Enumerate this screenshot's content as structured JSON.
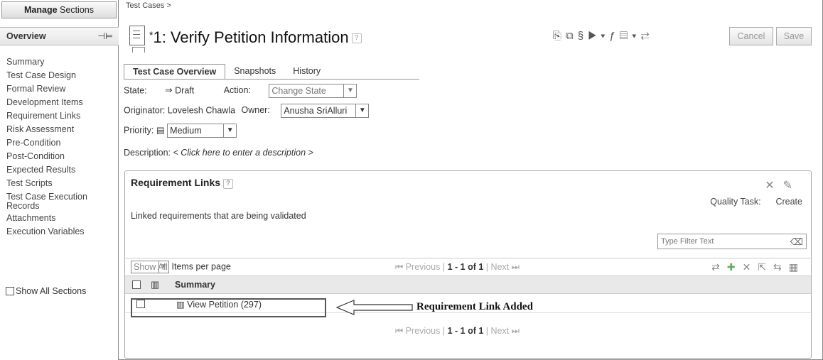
{
  "sidebar": {
    "manage_bold": "Manage",
    "manage_rest": " Sections",
    "overview": "Overview",
    "pin_icon": "⊣⊨",
    "items": [
      "Summary",
      "Test Case Design",
      "Formal Review",
      "Development Items",
      "Requirement Links",
      "Risk Assessment",
      "Pre-Condition",
      "Post-Condition",
      "Expected Results",
      "Test Scripts",
      "Test Case Execution Records",
      "Attachments",
      "Execution Variables"
    ],
    "show_all": "Show All Sections"
  },
  "header": {
    "breadcrumb": "Test Cases >",
    "title_star": "*",
    "title": "1: Verify Petition Information",
    "help": "?",
    "cancel": "Cancel",
    "save": "Save"
  },
  "tabs": [
    "Test Case Overview",
    "Snapshots",
    "History"
  ],
  "fields": {
    "state_label": "State:",
    "state_arrow": "⇒",
    "state_value": "Draft",
    "action_label": "Action:",
    "action_value": "Change State",
    "originator_label": "Originator:",
    "originator_value": "Lovelesh Chawla",
    "owner_label": "Owner:",
    "owner_value": "Anusha SriAlluri",
    "priority_label": "Priority:",
    "priority_value": "Medium",
    "description_label": "Description:",
    "description_value": "< Click here to enter a description >"
  },
  "panel": {
    "title": "Requirement Links",
    "help": "?",
    "quality_label": "Quality Task:",
    "quality_action": "Create",
    "description": "Linked requirements that are being validated",
    "filter_placeholder": "Type Filter Text",
    "show_all": "Show All",
    "items_per_page": "Items per page",
    "pager_prev": "⏮ Previous",
    "pager_sep": "|",
    "pager_range": "1 - 1 of 1",
    "pager_next": "Next ⏭",
    "column_summary": "Summary",
    "rows": [
      {
        "summary": "View Petition (297)"
      }
    ]
  },
  "annotation": "Requirement Link Added"
}
